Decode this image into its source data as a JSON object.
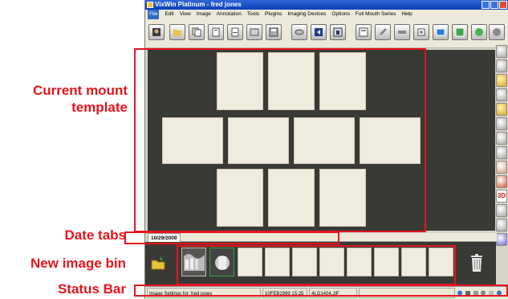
{
  "window": {
    "title": "VixWin Platinum - fred jones"
  },
  "menu": [
    "File",
    "Edit",
    "View",
    "Image",
    "Annotation",
    "Tools",
    "Plugins",
    "Imaging Devices",
    "Options",
    "Full Mouth Series",
    "Help"
  ],
  "toolbar": {
    "icons": [
      "patient-icon",
      "open-icon",
      "copy-icon",
      "paste-icon",
      "print-icon",
      "print-preview-icon",
      "save-icon",
      "scan-icon",
      "email-icon",
      "lock-icon",
      "template-icon",
      "edit-icon",
      "export-icon",
      "acquire-icon",
      "sensor-icon",
      "display-icon",
      "calibrate-icon",
      "settings-icon"
    ]
  },
  "right_toolbar": {
    "icons": [
      "zoom-icon",
      "rotate-icon",
      "flip-icon",
      "measure-icon",
      "brightness-icon",
      "contrast-icon",
      "sharpen-icon",
      "filter-icon",
      "color-icon",
      "invert-icon",
      "3d-icon",
      "compare-icon",
      "print-icon",
      "help-icon"
    ],
    "label_3d": "3D"
  },
  "date_tabs": [
    "10/29/2009"
  ],
  "status": {
    "message": "Image Settings for: fred jones",
    "datetime": "10FEB1999 15:25",
    "patient_id": "4LG1404.JIF"
  },
  "annotations": {
    "mount": {
      "line1": "Current mount",
      "line2": "template"
    },
    "dates": "Date tabs",
    "bin": "New image bin",
    "status": "Status Bar"
  },
  "colors": {
    "annotation": "#e8141c",
    "workspace": "#393936",
    "slot": "#efebdf",
    "title_bar": "#0a3fb6"
  }
}
